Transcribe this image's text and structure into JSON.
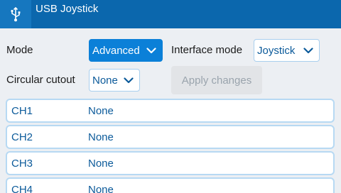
{
  "header": {
    "title": "USB Joystick",
    "icon": "usb-icon"
  },
  "settings": {
    "mode": {
      "label": "Mode",
      "value": "Advanced"
    },
    "interface_mode": {
      "label": "Interface mode",
      "value": "Joystick"
    },
    "circular_cutout": {
      "label": "Circular cutout",
      "value": "None"
    },
    "apply_label": "Apply changes"
  },
  "channels": [
    {
      "name": "CH1",
      "value": "None"
    },
    {
      "name": "CH2",
      "value": "None"
    },
    {
      "name": "CH3",
      "value": "None"
    },
    {
      "name": "CH4",
      "value": "None"
    }
  ],
  "colors": {
    "header": "#0b67ad",
    "accent": "#0b80d8",
    "text_link": "#0b5a9a",
    "background": "#eceff3"
  }
}
